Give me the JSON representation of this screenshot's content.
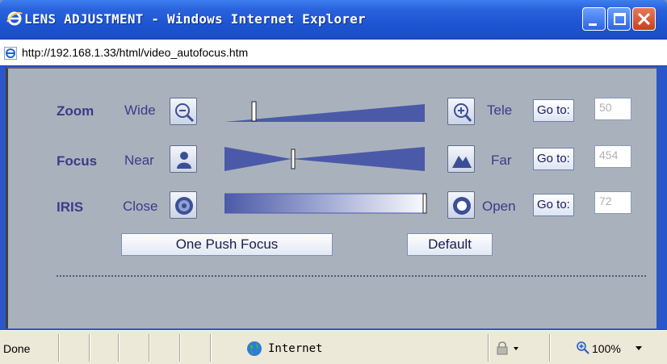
{
  "window": {
    "title": "LENS ADJUSTMENT - Windows Internet Explorer",
    "url": "http://192.168.1.33/html/video_autofocus.htm"
  },
  "controls": {
    "zoom": {
      "label": "Zoom",
      "min_label": "Wide",
      "max_label": "Tele",
      "goto_label": "Go to:",
      "value": "50",
      "level": 0.03
    },
    "focus": {
      "label": "Focus",
      "min_label": "Near",
      "max_label": "Far",
      "goto_label": "Go to:",
      "value": "454",
      "level": 0.33
    },
    "iris": {
      "label": "IRIS",
      "min_label": "Close",
      "max_label": "Open",
      "goto_label": "Go to:",
      "value": "72",
      "level": 1.0
    }
  },
  "buttons": {
    "one_push_focus": "One Push Focus",
    "default": "Default"
  },
  "status": {
    "text": "Done",
    "zone": "Internet",
    "zoom": "100%"
  },
  "colors": {
    "titlebar": "#2a62dc",
    "content_bg": "#a9b2bc",
    "label": "#3b3b8a",
    "slider": "#4b5aa8"
  },
  "icons": [
    "ie-logo-icon",
    "minimize-icon",
    "maximize-icon",
    "close-icon",
    "zoom-out-icon",
    "zoom-in-icon",
    "person-icon",
    "mountain-icon",
    "iris-close-icon",
    "iris-open-icon",
    "globe-icon",
    "lock-icon",
    "magnifier-icon"
  ]
}
